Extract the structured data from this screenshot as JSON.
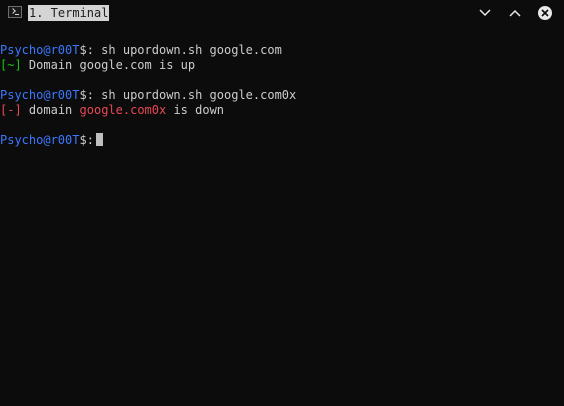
{
  "window": {
    "title": "1. Terminal",
    "controls": {
      "dropdown": "chevron-down-icon",
      "minimize": "chevron-up-icon",
      "close": "close-icon"
    }
  },
  "colors": {
    "background": "#0c0c0c",
    "prompt_user": "#3b78ff",
    "success": "#16c60c",
    "error": "#e74856",
    "text": "#cccccc"
  },
  "terminal": {
    "prompt_user": "Psycho@r00T",
    "prompt_symbol": "$:",
    "lines": [
      {
        "command": "sh upordown.sh google.com"
      },
      {
        "marker": "[~]",
        "text": "Domain google.com is up"
      },
      {
        "command": "sh upordown.sh google.com0x"
      },
      {
        "marker": "[-]",
        "text_before": "domain",
        "domain": "google.com0x",
        "text_after": "is down"
      }
    ]
  }
}
